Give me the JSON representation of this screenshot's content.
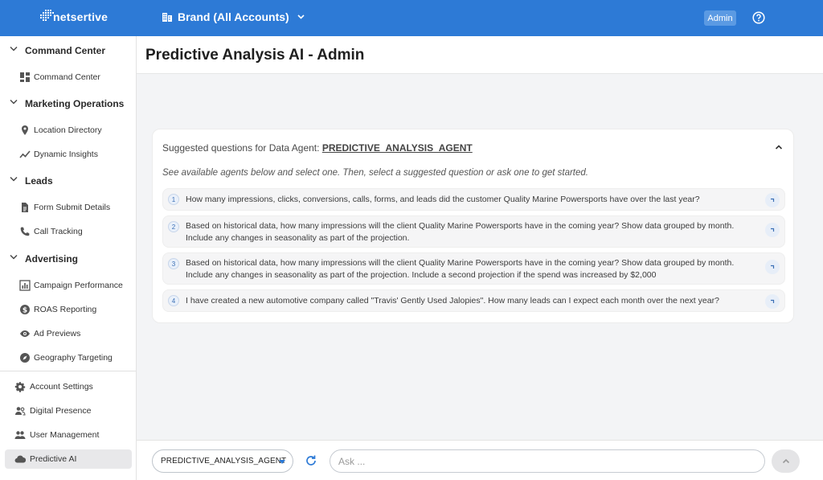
{
  "header": {
    "logo_text": "netsertive",
    "brand_label": "Brand (All Accounts)",
    "admin_label": "Admin"
  },
  "sidebar": {
    "sections": [
      {
        "label": "Command Center",
        "items": [
          {
            "label": "Command Center",
            "icon": "dashboard-icon"
          }
        ]
      },
      {
        "label": "Marketing Operations",
        "items": [
          {
            "label": "Location Directory",
            "icon": "location-pin-icon"
          },
          {
            "label": "Dynamic Insights",
            "icon": "trend-line-icon"
          }
        ]
      },
      {
        "label": "Leads",
        "items": [
          {
            "label": "Form Submit Details",
            "icon": "document-icon"
          },
          {
            "label": "Call Tracking",
            "icon": "phone-icon"
          }
        ]
      },
      {
        "label": "Advertising",
        "items": [
          {
            "label": "Campaign Performance",
            "icon": "bar-chart-icon"
          },
          {
            "label": "ROAS Reporting",
            "icon": "dollar-icon"
          },
          {
            "label": "Ad Previews",
            "icon": "eye-icon"
          },
          {
            "label": "Geography Targeting",
            "icon": "compass-icon"
          }
        ]
      }
    ],
    "bottom_items": [
      {
        "label": "Account Settings",
        "icon": "gear-icon"
      },
      {
        "label": "Digital Presence",
        "icon": "people-icon"
      },
      {
        "label": "User Management",
        "icon": "group-icon"
      },
      {
        "label": "Predictive AI",
        "icon": "cloud-icon",
        "active": true
      }
    ]
  },
  "page": {
    "title": "Predictive Analysis AI - Admin"
  },
  "suggestions": {
    "heading_prefix": "Suggested questions for Data Agent: ",
    "agent_name": "PREDICTIVE_ANALYSIS_AGENT",
    "subtitle": "See available agents below and select one. Then, select a suggested question or ask one to get started.",
    "questions": [
      {
        "num": "1",
        "text": "How many impressions, clicks, conversions, calls, forms, and leads did the customer Quality Marine Powersports have over the last year?"
      },
      {
        "num": "2",
        "text": "Based on historical data, how many impressions will the client Quality Marine Powersports have in the coming year? Show data grouped by month. Include any changes in seasonality as part of the projection."
      },
      {
        "num": "3",
        "text": "Based on historical data, how many impressions will the client Quality Marine Powersports have in the coming year? Show data grouped by month. Include any changes in seasonality as part of the projection. Include a second projection if the spend was increased by $2,000"
      },
      {
        "num": "4",
        "text": "I have created a new automotive company called \"Travis' Gently Used Jalopies\". How many leads can I expect each month over the next year?"
      }
    ]
  },
  "chat": {
    "agent_select": "PREDICTIVE_ANALYSIS_AGENT",
    "ask_placeholder": "Ask ...",
    "ask_value": ""
  },
  "colors": {
    "header_bg": "#2d7ad6",
    "admin_badge": "#5b9ae3",
    "accent": "#2d7ad6"
  }
}
